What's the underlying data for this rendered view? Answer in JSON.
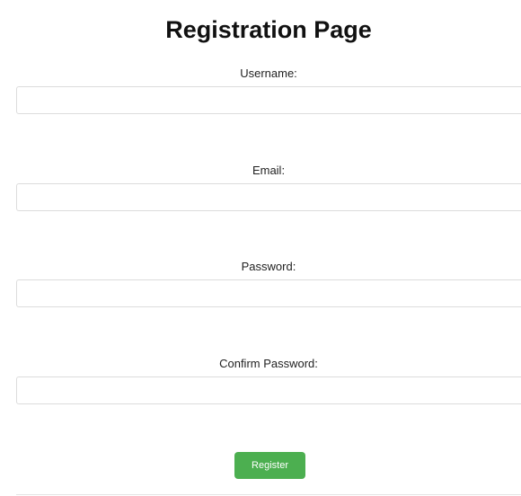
{
  "page": {
    "title": "Registration Page"
  },
  "form": {
    "username": {
      "label": "Username:",
      "value": "",
      "placeholder": ""
    },
    "email": {
      "label": "Email:",
      "value": "",
      "placeholder": ""
    },
    "password": {
      "label": "Password:",
      "value": "",
      "placeholder": ""
    },
    "confirm_password": {
      "label": "Confirm Password:",
      "value": "",
      "placeholder": ""
    },
    "submit_label": "Register"
  },
  "colors": {
    "button_bg": "#4caf50",
    "button_text": "#ffffff",
    "input_border": "#dcdcdc"
  }
}
